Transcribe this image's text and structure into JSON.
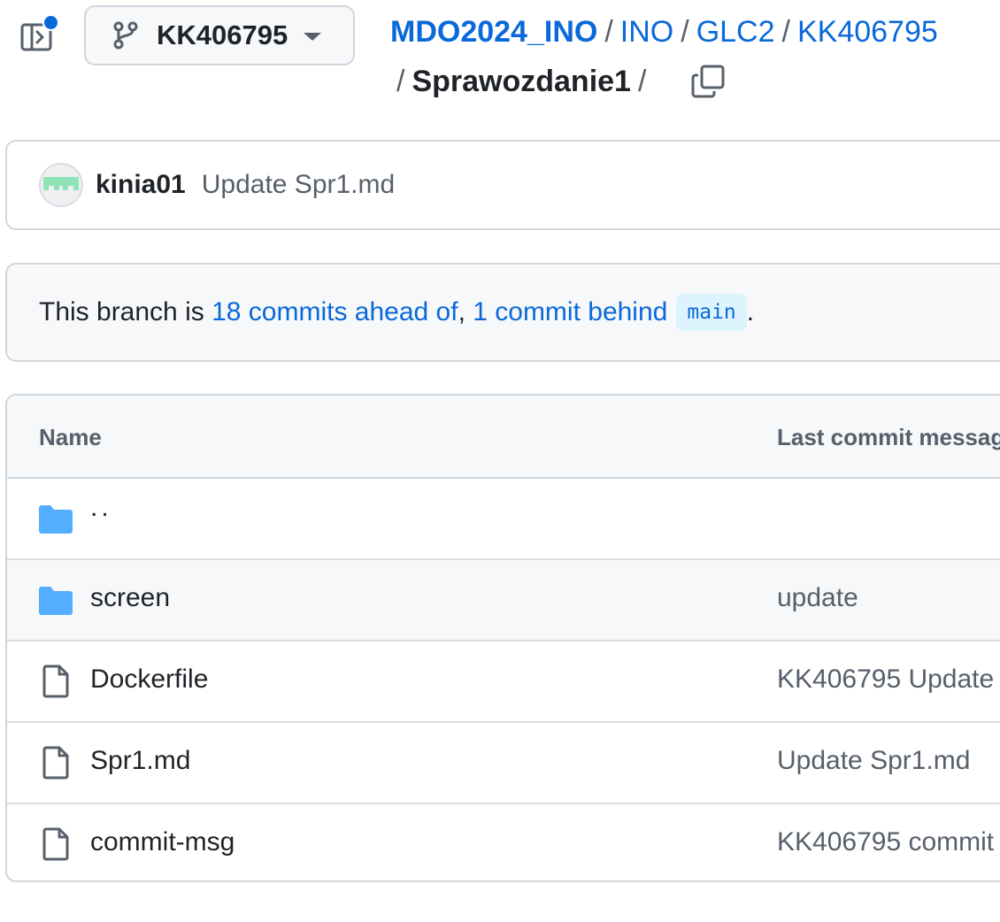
{
  "branch": {
    "name": "KK406795"
  },
  "breadcrumb": {
    "root": "MDO2024_INO",
    "items": [
      "INO",
      "GLC2",
      "KK406795"
    ],
    "current": "Sprawozdanie1",
    "separator": "/"
  },
  "latest_commit": {
    "author": "kinia01",
    "message": "Update Spr1.md"
  },
  "branch_status": {
    "prefix": "This branch is ",
    "ahead": "18 commits ahead of",
    "comma": ", ",
    "behind": "1 commit behind",
    "base_branch": "main",
    "suffix": "."
  },
  "table": {
    "headers": {
      "name": "Name",
      "last_commit": "Last commit message"
    },
    "rows": [
      {
        "type": "parent",
        "name": "..",
        "message": ""
      },
      {
        "type": "folder",
        "name": "screen",
        "message": "update"
      },
      {
        "type": "file",
        "name": "Dockerfile",
        "message": "KK406795 Update"
      },
      {
        "type": "file",
        "name": "Spr1.md",
        "message": "Update Spr1.md"
      },
      {
        "type": "file",
        "name": "commit-msg",
        "message": "KK406795 commit"
      }
    ]
  },
  "icons": {
    "sidebar": "sidebar-expand-icon",
    "branch": "git-branch-icon",
    "copy": "copy-icon",
    "folder": "folder-icon",
    "file": "file-icon"
  },
  "colors": {
    "link": "#0969da",
    "folder": "#54aeff",
    "notification_dot": "#0969da",
    "avatar_identicon": "#8fe3b6"
  }
}
